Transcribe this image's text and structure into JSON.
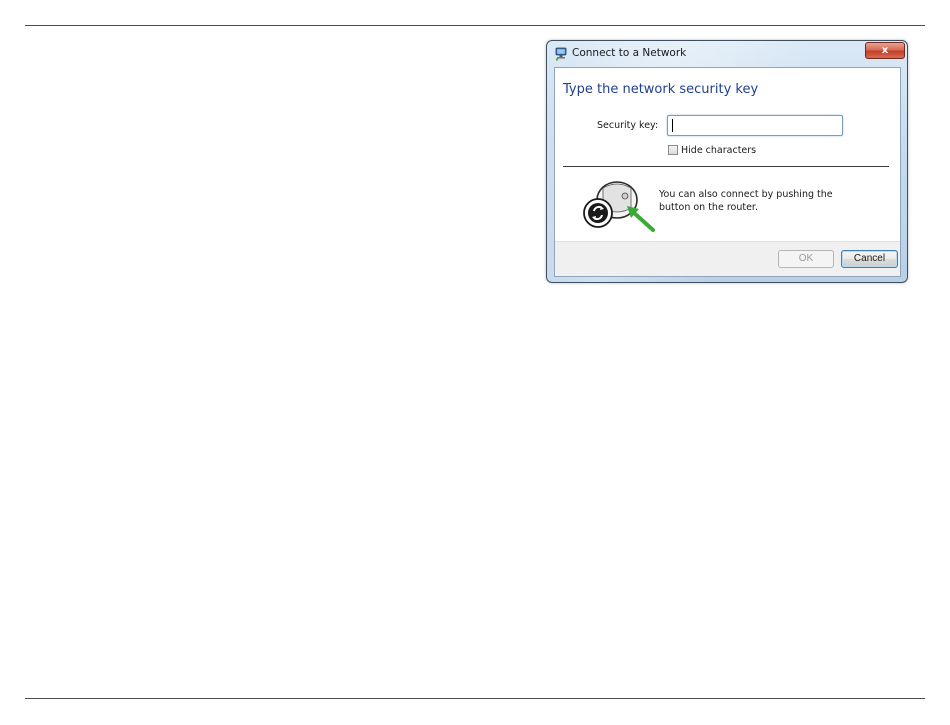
{
  "dialog": {
    "title": "Connect to a Network",
    "close_label": "x",
    "heading": "Type the network security key",
    "security_key_label": "Security key:",
    "security_key_value": "",
    "hide_characters_label": "Hide characters",
    "hide_characters_checked": false,
    "wps_line1": "You can also connect by pushing the",
    "wps_line2": "button on the router.",
    "ok_label": "OK",
    "cancel_label": "Cancel"
  },
  "icons": {
    "app": "network-connect-icon",
    "close": "close-icon",
    "wps": "wps-router-button-icon"
  },
  "colors": {
    "heading": "#1f3f8f",
    "close_button": "#c1412a",
    "wps_arrow": "#3aa935"
  }
}
